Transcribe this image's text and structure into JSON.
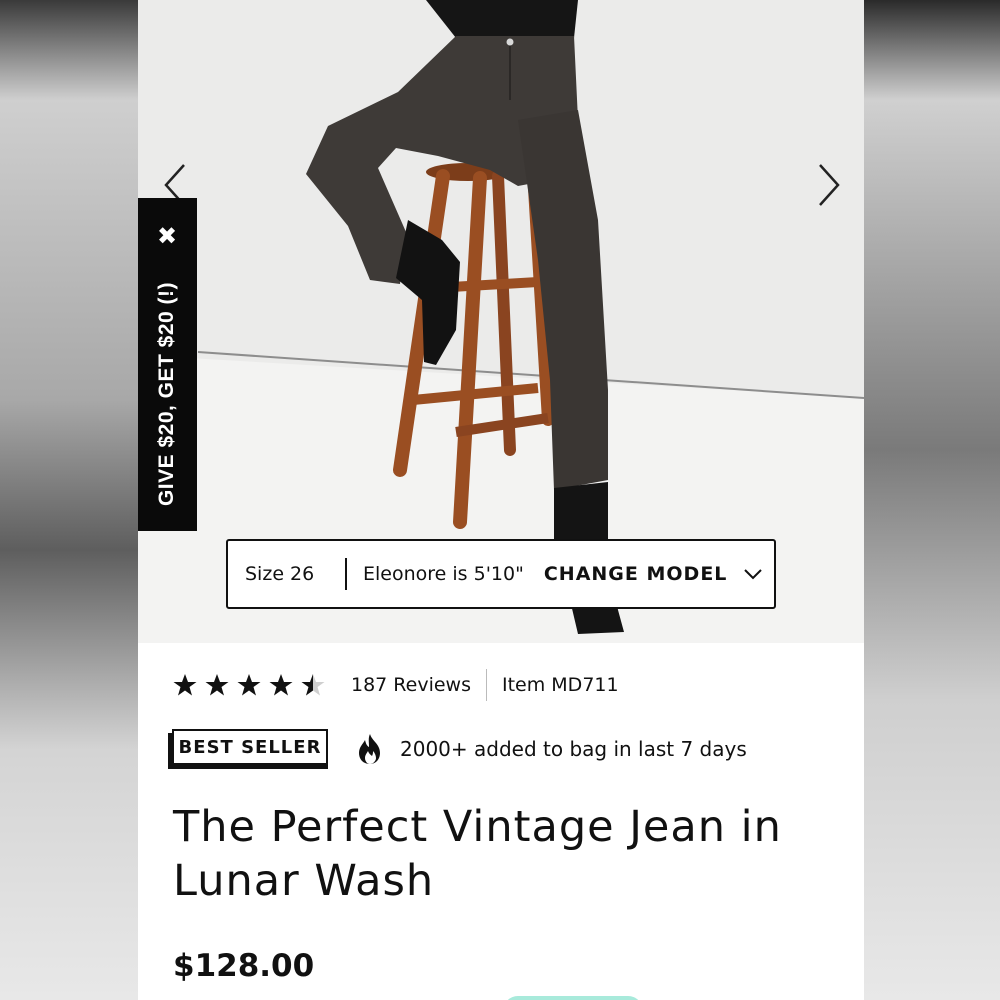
{
  "carousel": {
    "prev_icon": "chevron-left-icon",
    "next_icon": "chevron-right-icon"
  },
  "referral": {
    "text": "GIVE $20, GET $20 (!)",
    "close_glyph": "✖"
  },
  "model_bar": {
    "size": "Size 26",
    "model_info": "Eleonore is 5'10\"",
    "change_label": "CHANGE MODEL"
  },
  "rating": {
    "stars": 4.5,
    "reviews": "187 Reviews",
    "item": "Item MD711"
  },
  "badge": {
    "label": "BEST SELLER",
    "trend_text": "2000+ added to bag in last 7 days"
  },
  "product": {
    "title": "The Perfect Vintage Jean in Lunar Wash",
    "price": "$128.00"
  },
  "colors": {
    "accent_mint": "#a8eadb",
    "stool_wood": "#9a4e22",
    "denim": "#3e3a37"
  }
}
